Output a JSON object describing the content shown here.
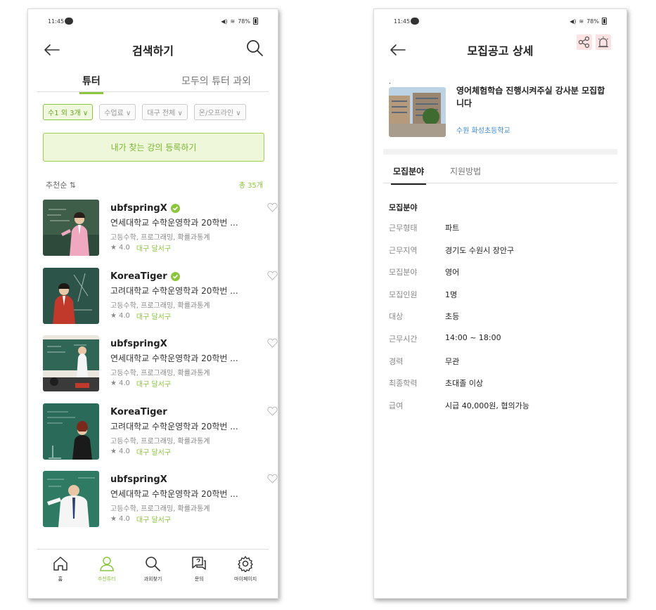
{
  "left": {
    "status": {
      "time": "11:45",
      "battery": "78%"
    },
    "header": {
      "title": "검색하기"
    },
    "tabs": [
      {
        "label": "튜터"
      },
      {
        "label": "모두의 튜터 과외"
      }
    ],
    "filters": [
      {
        "label": "수1 외 3개 ∨"
      },
      {
        "label": "수업료 ∨"
      },
      {
        "label": "대구 전체 ∨"
      },
      {
        "label": "온/오프라인 ∨"
      }
    ],
    "register_label": "내가 찾는 강의 등록하기",
    "sort_label": "추천순 ⇅",
    "total_label": "총 35개",
    "tutors": [
      {
        "name": "ubfspringX",
        "verified": true,
        "desc": "연세대학교 수학운영학과 20학번 ...",
        "subjects": "고등수학, 프로그래밍, 확률과통계",
        "rating": "4.0",
        "location": "대구 달서구"
      },
      {
        "name": "KoreaTiger",
        "verified": true,
        "desc": "고려대학교 수학운영학과 20학번 ...",
        "subjects": "고등수학, 프로그래밍, 확률과통계",
        "rating": "4.0",
        "location": "대구 달서구"
      },
      {
        "name": "ubfspringX",
        "verified": false,
        "desc": "연세대학교 수학운영학과 20학번 ...",
        "subjects": "고등수학, 프로그래밍, 확률과통계",
        "rating": "4.0",
        "location": "대구 달서구"
      },
      {
        "name": "KoreaTiger",
        "verified": false,
        "desc": "고려대학교 수학운영학과 20학번 ...",
        "subjects": "고등수학, 프로그래밍, 확률과통계",
        "rating": "4.0",
        "location": "대구 달서구"
      },
      {
        "name": "ubfspringX",
        "verified": false,
        "desc": "연세대학교 수학운영학과 20학번 ...",
        "subjects": "고등수학, 프로그래밍, 확률과통계",
        "rating": "4.0",
        "location": "대구 달서구"
      }
    ],
    "nav": [
      {
        "label": "홈",
        "icon": "home-icon"
      },
      {
        "label": "추천튜터",
        "icon": "person-icon"
      },
      {
        "label": "과외찾기",
        "icon": "search-icon"
      },
      {
        "label": "문의",
        "icon": "question-icon"
      },
      {
        "label": "마이페이지",
        "icon": "gear-icon"
      }
    ],
    "accent": "#8cc63f"
  },
  "right": {
    "status": {
      "time": "11:45",
      "battery": "78%"
    },
    "header": {
      "title": "모집공고 상세"
    },
    "job": {
      "marker": ".",
      "title": "영어체험학습 진행시켜주실 강사분 모집합니다",
      "school": "수원 화성초등학교"
    },
    "tabs": [
      {
        "label": "모집분야"
      },
      {
        "label": "지원방법"
      }
    ],
    "section_title": "모집분야",
    "info": [
      {
        "key": "근무형태",
        "value": "파트"
      },
      {
        "key": "근무지역",
        "value": "경기도 수원시 장안구"
      },
      {
        "key": "모집분야",
        "value": "영어"
      },
      {
        "key": "모집인원",
        "value": "1명"
      },
      {
        "key": "대상",
        "value": "초등"
      },
      {
        "key": "근무시간",
        "value": "14:00 ~ 18:00"
      },
      {
        "key": "경력",
        "value": "무관"
      },
      {
        "key": "최종학력",
        "value": "초대졸 이상"
      },
      {
        "key": "급여",
        "value": "시급 40,000원, 협의가능"
      }
    ],
    "link_color": "#3a8ad6"
  }
}
